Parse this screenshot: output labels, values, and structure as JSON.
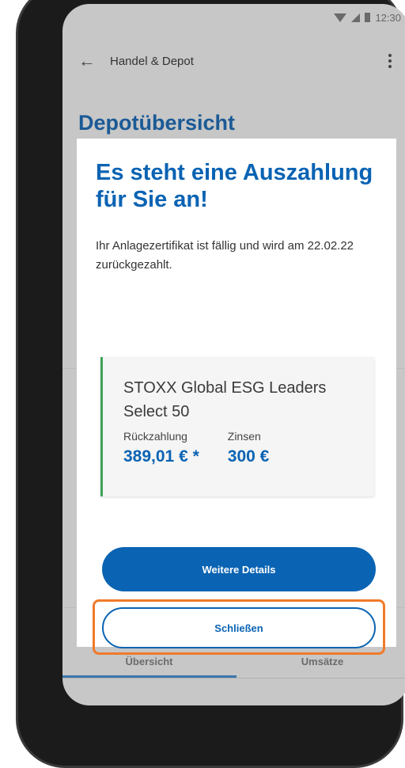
{
  "status_bar": {
    "time": "12:30"
  },
  "app_bar": {
    "title": "Handel & Depot"
  },
  "page": {
    "title": "Depotübersicht"
  },
  "tabs": [
    {
      "label": "Übersicht"
    },
    {
      "label": "Umsätze"
    }
  ],
  "dialog": {
    "title": "Es steht eine Auszahlung für Sie an!",
    "text": "Ihr Anlagezertifikat ist fällig und wird am 22.02.22 zurückgezahlt.",
    "card": {
      "product": "STOXX Global ESG Leaders Select 50",
      "repayment_label": "Rückzahlung",
      "repayment_value": "389,01 € *",
      "interest_label": "Zinsen",
      "interest_value": "300 €"
    },
    "primary_button": "Weitere Details",
    "secondary_button": "Schließen"
  },
  "colors": {
    "brand_blue": "#0a63b3",
    "card_accent": "#3ea35a",
    "highlight": "#f07a2a"
  }
}
